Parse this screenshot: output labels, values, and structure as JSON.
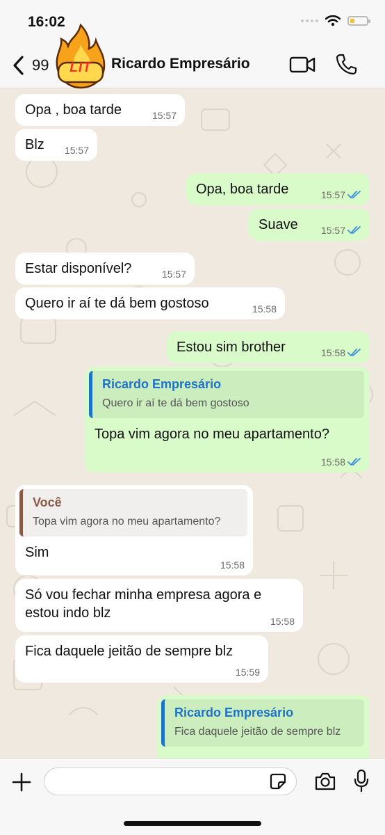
{
  "status": {
    "time": "16:02"
  },
  "header": {
    "back_count": "99",
    "avatar_text": "LIT",
    "contact_name": "Ricardo Empresário"
  },
  "messages": [
    {
      "dir": "in",
      "text": "Opa , boa tarde",
      "time": "15:57"
    },
    {
      "dir": "in",
      "text": "Blz",
      "time": "15:57"
    },
    {
      "dir": "out",
      "text": "Opa, boa tarde",
      "time": "15:57"
    },
    {
      "dir": "out",
      "text": "Suave",
      "time": "15:57"
    },
    {
      "dir": "in",
      "text": "Estar disponível?",
      "time": "15:57"
    },
    {
      "dir": "in",
      "text": "Quero ir aí te dá bem gostoso",
      "time": "15:58"
    },
    {
      "dir": "out",
      "text": "Estou sim brother",
      "time": "15:58"
    },
    {
      "dir": "out",
      "quote": {
        "name": "Ricardo Empresário",
        "text": "Quero ir aí te dá bem gostoso"
      },
      "text": "Topa vim agora no meu apartamento?",
      "time": "15:58"
    },
    {
      "dir": "in",
      "quote": {
        "name": "Você",
        "text": "Topa vim agora no meu apartamento?"
      },
      "text": "Sim",
      "time": "15:58"
    },
    {
      "dir": "in",
      "text": "Só vou fechar minha empresa agora e estou indo blz",
      "text_lines": [
        "Só vou fechar minha empresa agora e",
        "estou indo blz"
      ],
      "time": "15:58"
    },
    {
      "dir": "in",
      "text": "Fica daquele jeitão de sempre blz",
      "time": "15:59"
    },
    {
      "dir": "out",
      "quote": {
        "name": "Ricardo Empresário",
        "text": "Fica daquele jeitão de sempre blz"
      }
    }
  ],
  "composer": {
    "value": ""
  },
  "icons": {
    "back": "chevron-left-icon",
    "video": "video-camera-icon",
    "phone": "phone-icon",
    "plus": "plus-icon",
    "sticker": "sticker-icon",
    "camera": "camera-icon",
    "mic": "microphone-icon",
    "read": "double-check-icon"
  },
  "colors": {
    "incoming": "#ffffff",
    "outgoing": "#d8fbc9",
    "read_ticks": "#3b8fd6",
    "quote_blue": "#1e73c7",
    "quote_brown": "#8a5a44",
    "wallpaper": "#efe9df"
  }
}
